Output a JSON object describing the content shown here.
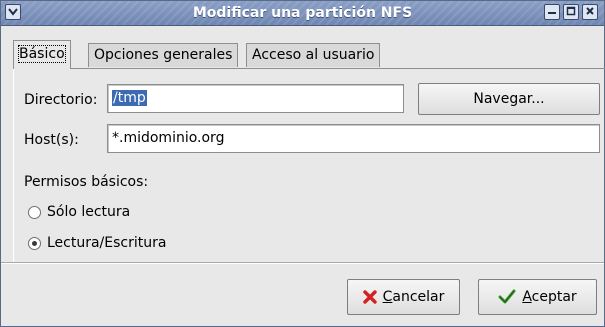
{
  "window": {
    "title": "Modificar una partición NFS"
  },
  "tabs": [
    {
      "label": "Básico",
      "active": true
    },
    {
      "label": "Opciones generales",
      "active": false
    },
    {
      "label": "Acceso al usuario",
      "active": false
    }
  ],
  "form": {
    "directory_label": "Directorio:",
    "directory_value": "/tmp",
    "browse_label": "Navegar...",
    "hosts_label": "Host(s):",
    "hosts_value": "*.midominio.org"
  },
  "permissions": {
    "heading": "Permisos básicos:",
    "options": [
      {
        "label": "Sólo lectura",
        "selected": false
      },
      {
        "label": "Lectura/Escritura",
        "selected": true
      }
    ]
  },
  "actions": {
    "cancel_mnemonic": "C",
    "cancel_rest": "ancelar",
    "ok_mnemonic": "A",
    "ok_rest": "ceptar"
  },
  "colors": {
    "titlebar": "#7b91bb",
    "selection": "#3d6ab1",
    "cancel_icon": "#d42020",
    "ok_icon": "#3a9a2a"
  },
  "icons": {
    "window_menu": "chevron-down-icon",
    "minimize": "minimize-icon",
    "maximize": "maximize-icon",
    "close": "close-icon",
    "cancel": "red-x-icon",
    "ok": "checkmark-icon"
  }
}
